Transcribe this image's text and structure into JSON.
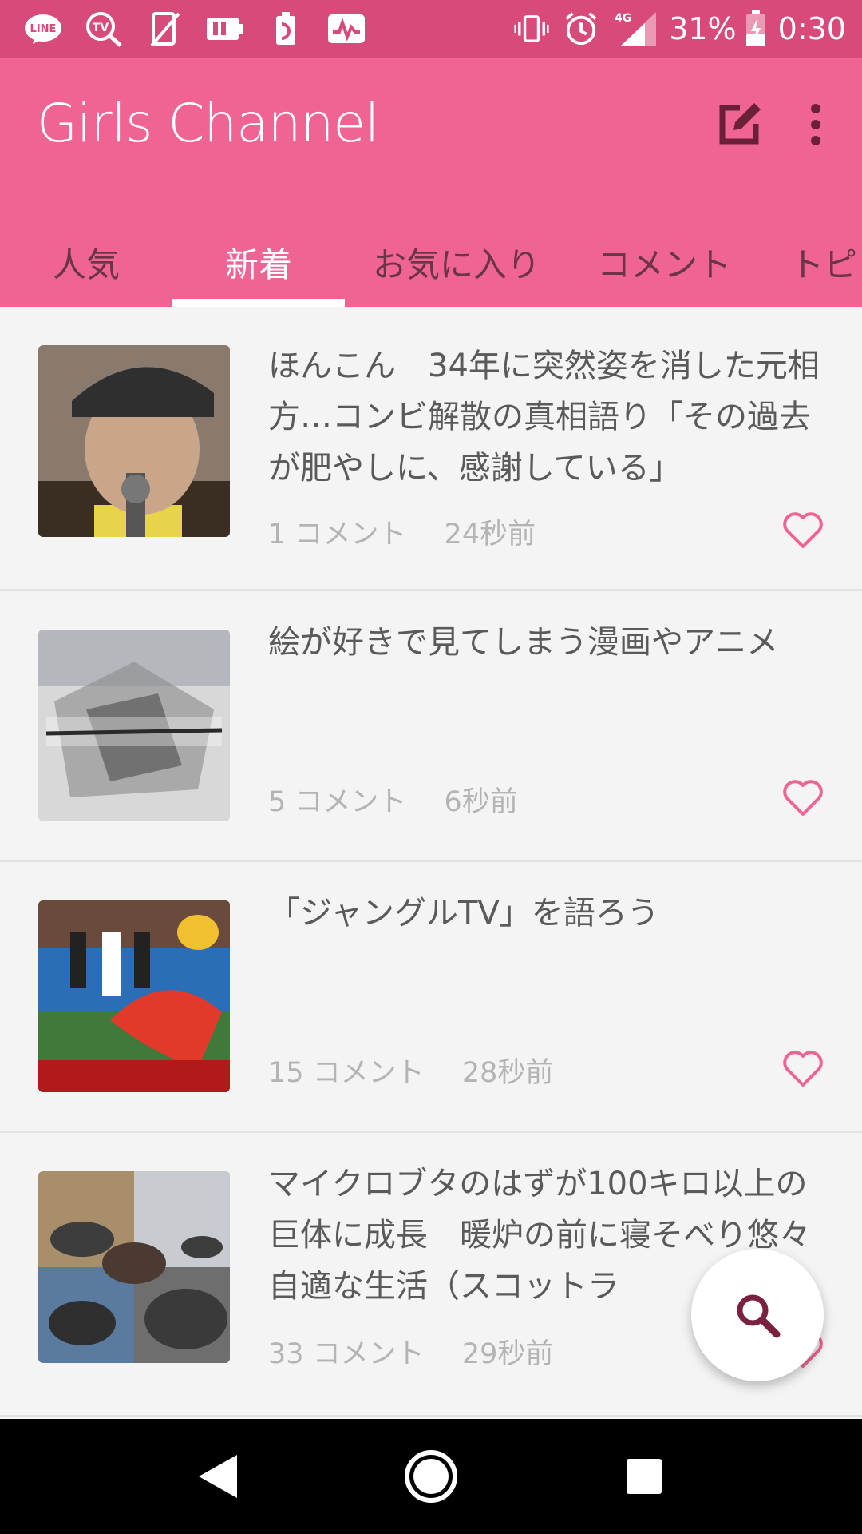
{
  "status_bar": {
    "left_icons": [
      "line-icon",
      "tv-search-icon",
      "no-sim-icon",
      "battery-saver-icon",
      "notification-icon",
      "activity-icon"
    ],
    "right_icons": [
      "vibrate-icon",
      "alarm-icon",
      "signal-4g-icon"
    ],
    "network": "4G",
    "battery_percent": "31%",
    "time": "0:30"
  },
  "app_bar": {
    "title": "Girls Channel",
    "actions": [
      "edit-icon",
      "more-vert-icon"
    ]
  },
  "tabs": [
    {
      "label": "人気",
      "active": false
    },
    {
      "label": "新着",
      "active": true
    },
    {
      "label": "お気に入り",
      "active": false
    },
    {
      "label": "コメント",
      "active": false
    },
    {
      "label": "トピ",
      "active": false
    }
  ],
  "topics": [
    {
      "title": "ほんこん　34年に突然姿を消した元相方…コンビ解散の真相語り「その過去が肥やしに、感謝している」",
      "comments": "1 コメント",
      "time": "24秒前",
      "thumb_colors": [
        "#5a4a3a",
        "#c9a68a",
        "#2f2f2f"
      ]
    },
    {
      "title": "絵が好きで見てしまう漫画やアニメ",
      "comments": "5 コメント",
      "time": "6秒前",
      "thumb_colors": [
        "#d8d8d8",
        "#8a8a8a",
        "#3a3a3a"
      ]
    },
    {
      "title": "「ジャングルTV」を語ろう",
      "comments": "15 コメント",
      "time": "28秒前",
      "thumb_colors": [
        "#3f7a3a",
        "#2a6fb5",
        "#e23a2a"
      ]
    },
    {
      "title": "マイクロブタのはずが100キロ以上の巨体に成長　暖炉の前に寝そべり悠々自適な生活（スコットラ",
      "comments": "33 コメント",
      "time": "29秒前",
      "thumb_colors": [
        "#6e6e6e",
        "#a88e6a",
        "#3d3d3d"
      ]
    }
  ],
  "colors": {
    "status_bar": "#d74a7a",
    "app_bar": "#f06494",
    "heart": "#f06494",
    "fab_icon": "#7a2140"
  },
  "fab": {
    "icon": "search-icon"
  },
  "nav_bar": {
    "buttons": [
      "back-icon",
      "home-icon",
      "recents-icon"
    ]
  }
}
